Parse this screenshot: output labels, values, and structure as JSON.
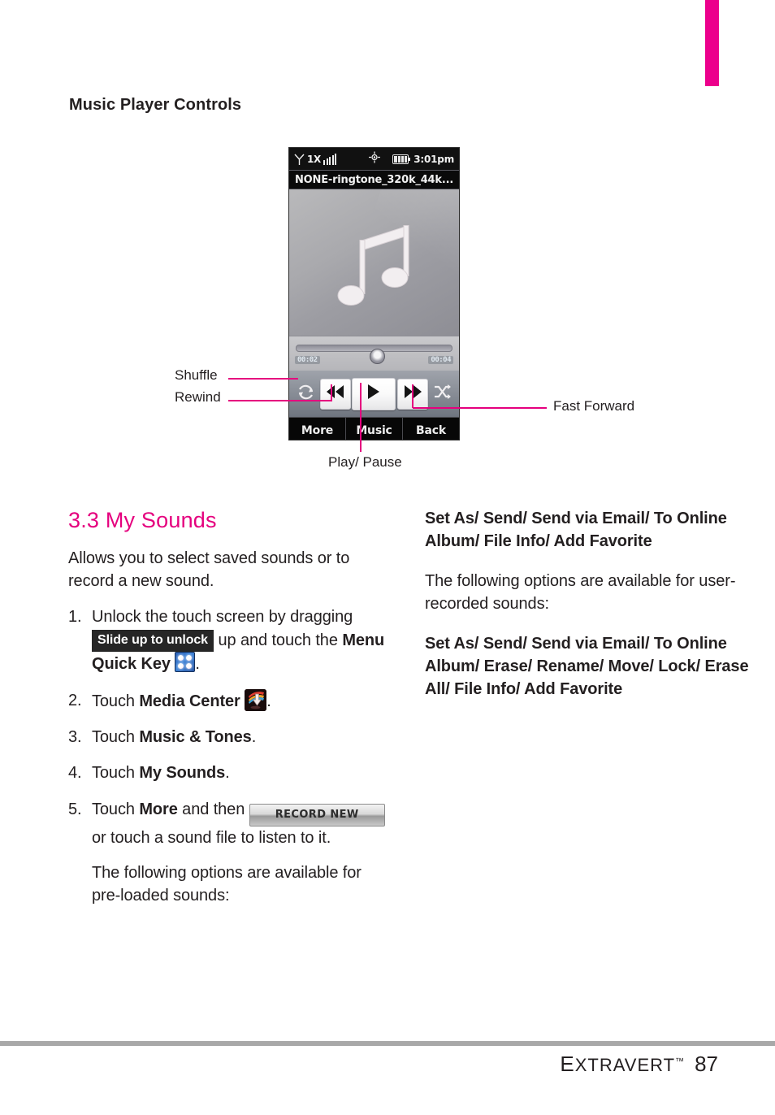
{
  "page": {
    "title": "Music Player Controls",
    "number": "87",
    "brand": "Extravert",
    "brand_first_letter": "E",
    "brand_rest": "XTRAVERT",
    "trademark": "™",
    "accent_color": "#e5007e",
    "tab_color": "#ec008c"
  },
  "phone": {
    "status_bar": {
      "network": "1X",
      "signal_icon": "signal-icon",
      "gps_icon": "location-icon",
      "battery_icon": "battery-icon",
      "time": "3:01pm"
    },
    "title_bar": "NONE-ringtone_320k_44k...",
    "artwork_icon": "music-note-icon",
    "seek": {
      "elapsed": "00:02",
      "total": "00:04",
      "position_percent": 47
    },
    "controls": [
      {
        "name": "repeat",
        "icon": "repeat-icon"
      },
      {
        "name": "rewind",
        "icon": "rewind-icon"
      },
      {
        "name": "play-pause",
        "icon": "play-icon"
      },
      {
        "name": "fast-forward",
        "icon": "fast-forward-icon"
      },
      {
        "name": "shuffle",
        "icon": "shuffle-icon"
      }
    ],
    "soft_keys": [
      "More",
      "Music",
      "Back"
    ]
  },
  "callouts": {
    "shuffle": "Shuffle",
    "rewind": "Rewind",
    "fast_forward": "Fast Forward",
    "play_pause": "Play/ Pause"
  },
  "left_column": {
    "heading": "3.3 My Sounds",
    "intro": "Allows you to select saved sounds or to record a new sound.",
    "steps": [
      {
        "num": "1.",
        "parts": [
          {
            "type": "text",
            "value": "Unlock the touch screen by dragging "
          },
          {
            "type": "chip-dark",
            "value": "Slide up to unlock"
          },
          {
            "type": "text",
            "value": " up and touch the "
          },
          {
            "type": "bold",
            "value": "Menu Quick Key"
          },
          {
            "type": "icon",
            "value": "menu-quick-key-icon"
          },
          {
            "type": "text",
            "value": "."
          }
        ]
      },
      {
        "num": "2.",
        "parts": [
          {
            "type": "text",
            "value": "Touch "
          },
          {
            "type": "bold",
            "value": "Media Center"
          },
          {
            "type": "icon",
            "value": "media-center-icon"
          },
          {
            "type": "text",
            "value": "."
          }
        ]
      },
      {
        "num": "3.",
        "parts": [
          {
            "type": "text",
            "value": "Touch "
          },
          {
            "type": "bold",
            "value": "Music & Tones"
          },
          {
            "type": "text",
            "value": "."
          }
        ]
      },
      {
        "num": "4.",
        "parts": [
          {
            "type": "text",
            "value": "Touch "
          },
          {
            "type": "bold",
            "value": "My Sounds"
          },
          {
            "type": "text",
            "value": "."
          }
        ]
      },
      {
        "num": "5.",
        "parts": [
          {
            "type": "text",
            "value": "Touch "
          },
          {
            "type": "bold",
            "value": "More"
          },
          {
            "type": "text",
            "value": " and then "
          },
          {
            "type": "chip-button",
            "value": "RECORD NEW"
          },
          {
            "type": "text",
            "value": " or touch a sound file to listen to it."
          }
        ]
      }
    ],
    "step1_lead": "Unlock the touch screen by dragging ",
    "step1_chip": "Slide up to unlock",
    "step1_mid": " up and touch the ",
    "step1_bold": "Menu Quick Key",
    "step2_lead": "Touch ",
    "step2_bold": "Media Center",
    "step3_lead": "Touch ",
    "step3_bold": "Music & Tones",
    "step4_lead": "Touch ",
    "step4_bold": "My Sounds",
    "step5_lead": "Touch ",
    "step5_bold": "More",
    "step5_mid": " and then ",
    "step5_chip": "RECORD NEW",
    "step5_tail": " or touch a sound file to listen to it.",
    "note": "The following options are available for pre-loaded sounds:"
  },
  "right_column": {
    "options_preloaded": "Set As/ Send/ Send via Email/ To Online Album/ File Info/ Add Favorite",
    "note": "The following options are available for user-recorded sounds:",
    "options_recorded": "Set As/ Send/ Send via Email/ To Online Album/ Erase/ Rename/ Move/ Lock/ Erase All/ File Info/ Add Favorite"
  }
}
